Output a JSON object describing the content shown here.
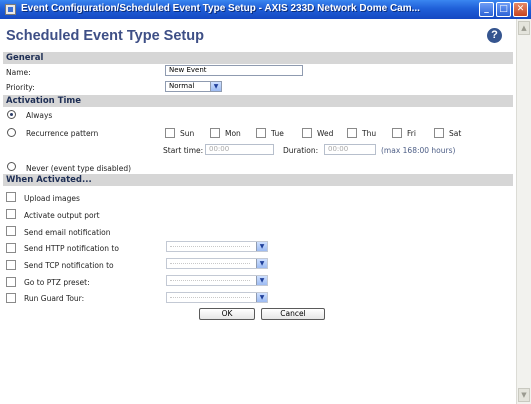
{
  "window": {
    "title": "Event Configuration/Scheduled Event Type Setup - AXIS 233D Network Dome Cam...",
    "buttons": {
      "minimize": "_",
      "maximize": "□",
      "close": "✕"
    }
  },
  "page": {
    "title": "Scheduled Event Type Setup",
    "help": "?"
  },
  "general": {
    "heading": "General",
    "name_label": "Name:",
    "name_value": "New Event",
    "priority_label": "Priority:",
    "priority_value": "Normal"
  },
  "activation": {
    "heading": "Activation Time",
    "always_label": "Always",
    "recurrence_label": "Recurrence pattern",
    "days": [
      "Sun",
      "Mon",
      "Tue",
      "Wed",
      "Thu",
      "Fri",
      "Sat"
    ],
    "start_label": "Start time:",
    "start_placeholder": "00:00",
    "duration_label": "Duration:",
    "duration_placeholder": "00:00",
    "duration_hint": "(max 168:00 hours)",
    "never_label": "Never (event type disabled)",
    "selected": "always"
  },
  "when_activated": {
    "heading": "When Activated...",
    "options": [
      "Upload images",
      "Activate output port",
      "Send email notification",
      "Send HTTP notification to",
      "Send TCP notification to",
      "Go to PTZ preset:",
      "Run Guard Tour:"
    ]
  },
  "actions": {
    "ok": "OK",
    "cancel": "Cancel"
  },
  "colors": {
    "titlebar": "#1f5fd8",
    "heading": "#3e4f86",
    "section_bar": "#d6d6d6"
  }
}
